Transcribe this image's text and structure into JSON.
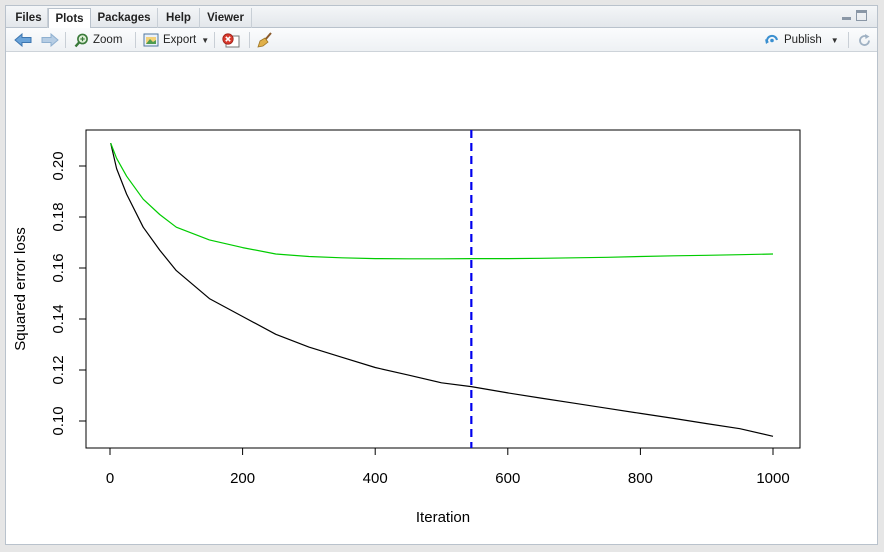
{
  "tabs": [
    {
      "label": "Files",
      "active": false
    },
    {
      "label": "Plots",
      "active": true
    },
    {
      "label": "Packages",
      "active": false
    },
    {
      "label": "Help",
      "active": false
    },
    {
      "label": "Viewer",
      "active": false
    }
  ],
  "toolbar": {
    "zoom_label": "Zoom",
    "export_label": "Export",
    "publish_label": "Publish"
  },
  "chart_data": {
    "type": "line",
    "title": "",
    "xlabel": "Iteration",
    "ylabel": "Squared error loss",
    "xlim": [
      0,
      1000
    ],
    "ylim": [
      0.09,
      0.21
    ],
    "x_ticks": [
      "0",
      "200",
      "400",
      "600",
      "800",
      "1000"
    ],
    "y_ticks": [
      "0.10",
      "0.12",
      "0.14",
      "0.16",
      "0.18",
      "0.20"
    ],
    "series": [
      {
        "color": "#000000",
        "x": [
          1,
          10,
          25,
          50,
          75,
          100,
          150,
          200,
          250,
          300,
          350,
          400,
          450,
          500,
          545,
          600,
          650,
          700,
          750,
          800,
          850,
          900,
          950,
          1000
        ],
        "values": [
          0.209,
          0.199,
          0.189,
          0.176,
          0.167,
          0.159,
          0.148,
          0.141,
          0.134,
          0.129,
          0.125,
          0.121,
          0.118,
          0.115,
          0.1135,
          0.111,
          0.109,
          0.107,
          0.105,
          0.103,
          0.101,
          0.099,
          0.097,
          0.094
        ]
      },
      {
        "color": "#00cc00",
        "x": [
          1,
          10,
          25,
          50,
          75,
          100,
          150,
          200,
          250,
          300,
          350,
          400,
          450,
          500,
          545,
          600,
          650,
          700,
          750,
          800,
          850,
          900,
          950,
          1000
        ],
        "values": [
          0.209,
          0.203,
          0.196,
          0.187,
          0.181,
          0.176,
          0.171,
          0.168,
          0.1655,
          0.1645,
          0.164,
          0.1637,
          0.1636,
          0.1636,
          0.1637,
          0.1637,
          0.1638,
          0.164,
          0.1642,
          0.1645,
          0.1648,
          0.165,
          0.1652,
          0.1655
        ]
      }
    ],
    "vline": {
      "x": 545,
      "color": "#0000ee",
      "style": "dashed"
    }
  }
}
